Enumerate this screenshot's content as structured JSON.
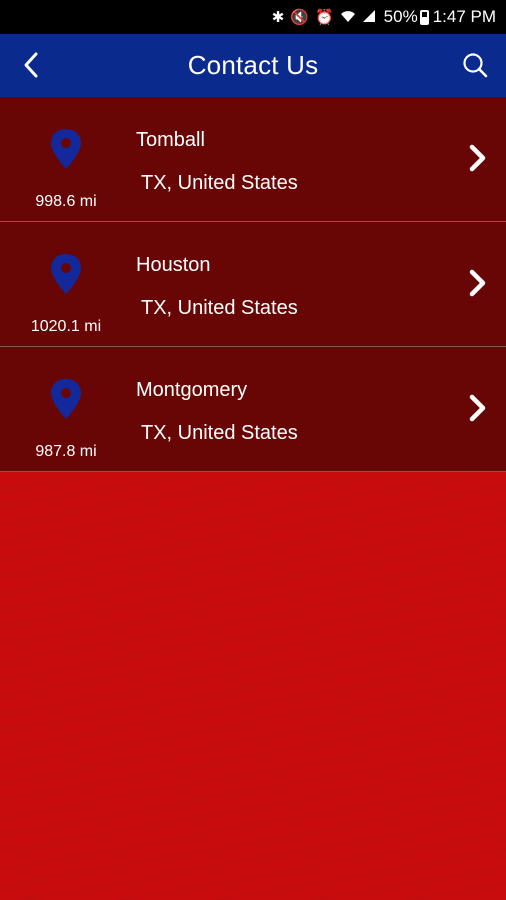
{
  "status_bar": {
    "battery": "50%",
    "time": "1:47 PM",
    "icons": [
      "bluetooth-icon",
      "mute-icon",
      "alarm-icon",
      "wifi-icon",
      "signal-icon",
      "battery-icon"
    ]
  },
  "app_bar": {
    "title": "Contact Us",
    "back_icon": "chevron-left-icon",
    "search_icon": "search-icon"
  },
  "locations": [
    {
      "name": "Tomball",
      "region": "TX, United States",
      "distance": "998.6 mi"
    },
    {
      "name": "Houston",
      "region": "TX, United States",
      "distance": "1020.1 mi"
    },
    {
      "name": "Montgomery",
      "region": "TX, United States",
      "distance": "987.8 mi"
    }
  ],
  "colors": {
    "app_bar": "#0b2a8e",
    "row_background": "#680606",
    "page_background": "#c80c0e",
    "pin": "#13289a"
  }
}
